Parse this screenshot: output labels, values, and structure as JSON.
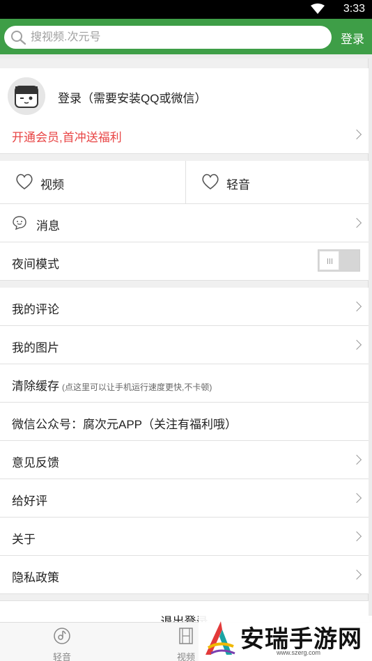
{
  "status_bar": {
    "time": "3:33"
  },
  "search": {
    "placeholder": "搜视频.次元号"
  },
  "header": {
    "login_label": "登录"
  },
  "profile": {
    "login_prompt": "登录（需要安装QQ或微信）"
  },
  "vip": {
    "label": "开通会员,首冲送福利"
  },
  "favorites": {
    "video_label": "视频",
    "audio_label": "轻音"
  },
  "message": {
    "label": "消息"
  },
  "night_mode": {
    "label": "夜间模式",
    "enabled": false
  },
  "menu": {
    "my_comments": "我的评论",
    "my_pictures": "我的图片",
    "clear_cache": "清除缓存",
    "clear_cache_hint": "(点这里可以让手机运行速度更快,不卡顿)",
    "wechat": "微信公众号：腐次元APP（关注有福利哦）",
    "feedback": "意见反馈",
    "rate": "给好评",
    "about": "关于",
    "privacy": "隐私政策"
  },
  "logout": {
    "label": "退出登录"
  },
  "tabs": [
    {
      "label": "轻音",
      "icon": "music-disc-icon"
    },
    {
      "label": "视频",
      "icon": "film-icon"
    }
  ],
  "watermark": {
    "text": "安瑞手游网",
    "url": "www.szerg.com"
  },
  "colors": {
    "brand_green": "#3e9e47",
    "vip_red": "#e84545"
  }
}
